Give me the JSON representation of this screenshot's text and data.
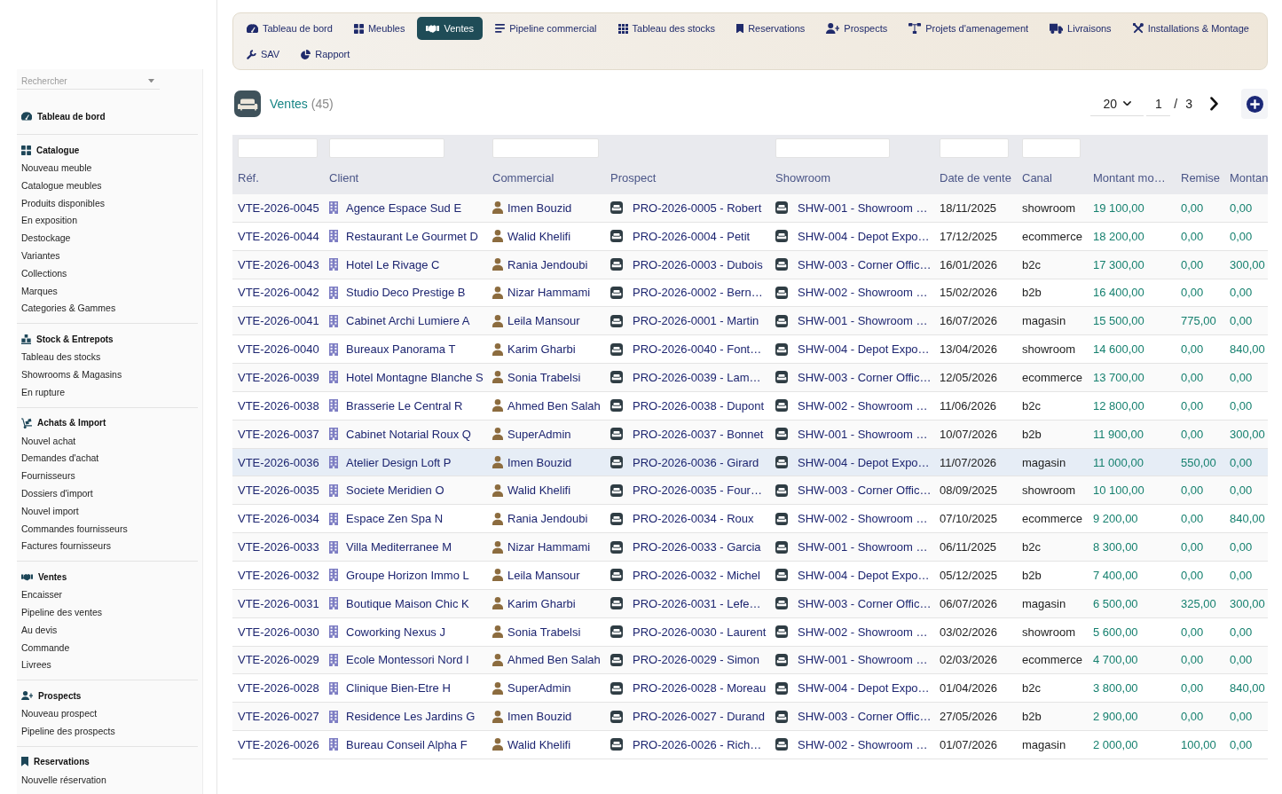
{
  "sidebar": {
    "search": {
      "placeholder": "Rechercher"
    },
    "sections": [
      {
        "title": "Tableau de bord"
      },
      {
        "title": "Catalogue",
        "items": [
          "Nouveau meuble",
          "Catalogue meubles",
          "Produits disponibles",
          "En exposition",
          "Destockage",
          "Variantes",
          "Collections",
          "Marques",
          "Categories & Gammes"
        ]
      },
      {
        "title": "Stock & Entrepots",
        "items": [
          "Tableau des stocks",
          "Showrooms & Magasins",
          "En rupture"
        ]
      },
      {
        "title": "Achats & Import",
        "items": [
          "Nouvel achat",
          "Demandes d'achat",
          "Fournisseurs",
          "Dossiers d'import",
          "Nouvel import",
          "Commandes fournisseurs",
          "Factures fournisseurs"
        ]
      },
      {
        "title": "Ventes",
        "items": [
          "Encaisser",
          "Pipeline des ventes",
          "Au devis",
          "Commande",
          "Livrees"
        ]
      },
      {
        "title": "Prospects",
        "items": [
          "Nouveau prospect",
          "Pipeline des prospects"
        ]
      },
      {
        "title": "Reservations",
        "items": [
          "Nouvelle réservation"
        ]
      }
    ]
  },
  "tabs": [
    {
      "label": "Tableau de bord",
      "selected": false
    },
    {
      "label": "Meubles",
      "selected": false
    },
    {
      "label": "Ventes",
      "selected": true
    },
    {
      "label": "Pipeline commercial",
      "selected": false
    },
    {
      "label": "Tableau des stocks",
      "selected": false
    },
    {
      "label": "Reservations",
      "selected": false
    },
    {
      "label": "Prospects",
      "selected": false
    },
    {
      "label": "Projets d'amenagement",
      "selected": false
    },
    {
      "label": "Livraisons",
      "selected": false
    },
    {
      "label": "Installations & Montage",
      "selected": false
    },
    {
      "label": "SAV",
      "selected": false
    },
    {
      "label": "Rapport",
      "selected": false
    }
  ],
  "header": {
    "title": "Ventes",
    "count": "(45)"
  },
  "pagination": {
    "page_size": "20",
    "page": "1",
    "separator": "/",
    "page_count": "3"
  },
  "table": {
    "columns": [
      {
        "label": "Réf.",
        "filter": true
      },
      {
        "label": "Client",
        "filter": true
      },
      {
        "label": "Commercial",
        "filter": true
      },
      {
        "label": "Prospect",
        "filter": false
      },
      {
        "label": "Showroom",
        "filter": true
      },
      {
        "label": "Date de vente",
        "filter": true
      },
      {
        "label": "Canal",
        "filter": true
      },
      {
        "label": "Montant mo…",
        "filter": false
      },
      {
        "label": "Remise",
        "filter": false
      },
      {
        "label": "Montan",
        "filter": false
      }
    ],
    "rows": [
      {
        "ref": "VTE-2026-0045",
        "client": "Agence Espace Sud E",
        "commercial": "Imen Bouzid",
        "prospect": "PRO-2026-0005 - Robert",
        "showroom": "SHW-001 - Showroom …",
        "date": "18/11/2025",
        "canal": "showroom",
        "montant": "19 100,00",
        "remise": "0,00",
        "column_10": "0,00",
        "selected": false
      },
      {
        "ref": "VTE-2026-0044",
        "client": "Restaurant Le Gourmet D",
        "commercial": "Walid Khelifi",
        "prospect": "PRO-2026-0004 - Petit",
        "showroom": "SHW-004 - Depot Expo…",
        "date": "17/12/2025",
        "canal": "ecommerce",
        "montant": "18 200,00",
        "remise": "0,00",
        "column_10": "0,00",
        "selected": false
      },
      {
        "ref": "VTE-2026-0043",
        "client": "Hotel Le Rivage C",
        "commercial": "Rania Jendoubi",
        "prospect": "PRO-2026-0003 - Dubois",
        "showroom": "SHW-003 - Corner Offic…",
        "date": "16/01/2026",
        "canal": "b2c",
        "montant": "17 300,00",
        "remise": "0,00",
        "column_10": "300,00",
        "selected": false
      },
      {
        "ref": "VTE-2026-0042",
        "client": "Studio Deco Prestige B",
        "commercial": "Nizar Hammami",
        "prospect": "PRO-2026-0002 - Bern…",
        "showroom": "SHW-002 - Showroom …",
        "date": "15/02/2026",
        "canal": "b2b",
        "montant": "16 400,00",
        "remise": "0,00",
        "column_10": "0,00",
        "selected": false
      },
      {
        "ref": "VTE-2026-0041",
        "client": "Cabinet Archi Lumiere A",
        "commercial": "Leila Mansour",
        "prospect": "PRO-2026-0001 - Martin",
        "showroom": "SHW-001 - Showroom …",
        "date": "16/07/2026",
        "canal": "magasin",
        "montant": "15 500,00",
        "remise": "775,00",
        "column_10": "0,00",
        "selected": false
      },
      {
        "ref": "VTE-2026-0040",
        "client": "Bureaux Panorama T",
        "commercial": "Karim Gharbi",
        "prospect": "PRO-2026-0040 - Font…",
        "showroom": "SHW-004 - Depot Expo…",
        "date": "13/04/2026",
        "canal": "showroom",
        "montant": "14 600,00",
        "remise": "0,00",
        "column_10": "840,00",
        "selected": false
      },
      {
        "ref": "VTE-2026-0039",
        "client": "Hotel Montagne Blanche S",
        "commercial": "Sonia Trabelsi",
        "prospect": "PRO-2026-0039 - Lam…",
        "showroom": "SHW-003 - Corner Offic…",
        "date": "12/05/2026",
        "canal": "ecommerce",
        "montant": "13 700,00",
        "remise": "0,00",
        "column_10": "0,00",
        "selected": false
      },
      {
        "ref": "VTE-2026-0038",
        "client": "Brasserie Le Central R",
        "commercial": "Ahmed Ben Salah",
        "prospect": "PRO-2026-0038 - Dupont",
        "showroom": "SHW-002 - Showroom …",
        "date": "11/06/2026",
        "canal": "b2c",
        "montant": "12 800,00",
        "remise": "0,00",
        "column_10": "0,00",
        "selected": false
      },
      {
        "ref": "VTE-2026-0037",
        "client": "Cabinet Notarial Roux Q",
        "commercial": "SuperAdmin",
        "prospect": "PRO-2026-0037 - Bonnet",
        "showroom": "SHW-001 - Showroom …",
        "date": "10/07/2026",
        "canal": "b2b",
        "montant": "11 900,00",
        "remise": "0,00",
        "column_10": "300,00",
        "selected": false
      },
      {
        "ref": "VTE-2026-0036",
        "client": "Atelier Design Loft P",
        "commercial": "Imen Bouzid",
        "prospect": "PRO-2026-0036 - Girard",
        "showroom": "SHW-004 - Depot Expo…",
        "date": "11/07/2026",
        "canal": "magasin",
        "montant": "11 000,00",
        "remise": "550,00",
        "column_10": "0,00",
        "selected": true
      },
      {
        "ref": "VTE-2026-0035",
        "client": "Societe Meridien O",
        "commercial": "Walid Khelifi",
        "prospect": "PRO-2026-0035 - Four…",
        "showroom": "SHW-003 - Corner Offic…",
        "date": "08/09/2025",
        "canal": "showroom",
        "montant": "10 100,00",
        "remise": "0,00",
        "column_10": "0,00",
        "selected": false
      },
      {
        "ref": "VTE-2026-0034",
        "client": "Espace Zen Spa N",
        "commercial": "Rania Jendoubi",
        "prospect": "PRO-2026-0034 - Roux",
        "showroom": "SHW-002 - Showroom …",
        "date": "07/10/2025",
        "canal": "ecommerce",
        "montant": "9 200,00",
        "remise": "0,00",
        "column_10": "840,00",
        "selected": false
      },
      {
        "ref": "VTE-2026-0033",
        "client": "Villa Mediterranee M",
        "commercial": "Nizar Hammami",
        "prospect": "PRO-2026-0033 - Garcia",
        "showroom": "SHW-001 - Showroom …",
        "date": "06/11/2025",
        "canal": "b2c",
        "montant": "8 300,00",
        "remise": "0,00",
        "column_10": "0,00",
        "selected": false
      },
      {
        "ref": "VTE-2026-0032",
        "client": "Groupe Horizon Immo L",
        "commercial": "Leila Mansour",
        "prospect": "PRO-2026-0032 - Michel",
        "showroom": "SHW-004 - Depot Expo…",
        "date": "05/12/2025",
        "canal": "b2b",
        "montant": "7 400,00",
        "remise": "0,00",
        "column_10": "0,00",
        "selected": false
      },
      {
        "ref": "VTE-2026-0031",
        "client": "Boutique Maison Chic K",
        "commercial": "Karim Gharbi",
        "prospect": "PRO-2026-0031 - Lefe…",
        "showroom": "SHW-003 - Corner Offic…",
        "date": "06/07/2026",
        "canal": "magasin",
        "montant": "6 500,00",
        "remise": "325,00",
        "column_10": "300,00",
        "selected": false
      },
      {
        "ref": "VTE-2026-0030",
        "client": "Coworking Nexus J",
        "commercial": "Sonia Trabelsi",
        "prospect": "PRO-2026-0030 - Laurent",
        "showroom": "SHW-002 - Showroom …",
        "date": "03/02/2026",
        "canal": "showroom",
        "montant": "5 600,00",
        "remise": "0,00",
        "column_10": "0,00",
        "selected": false
      },
      {
        "ref": "VTE-2026-0029",
        "client": "Ecole Montessori Nord I",
        "commercial": "Ahmed Ben Salah",
        "prospect": "PRO-2026-0029 - Simon",
        "showroom": "SHW-001 - Showroom …",
        "date": "02/03/2026",
        "canal": "ecommerce",
        "montant": "4 700,00",
        "remise": "0,00",
        "column_10": "0,00",
        "selected": false
      },
      {
        "ref": "VTE-2026-0028",
        "client": "Clinique Bien-Etre H",
        "commercial": "SuperAdmin",
        "prospect": "PRO-2026-0028 - Moreau",
        "showroom": "SHW-004 - Depot Expo…",
        "date": "01/04/2026",
        "canal": "b2c",
        "montant": "3 800,00",
        "remise": "0,00",
        "column_10": "840,00",
        "selected": false
      },
      {
        "ref": "VTE-2026-0027",
        "client": "Residence Les Jardins G",
        "commercial": "Imen Bouzid",
        "prospect": "PRO-2026-0027 - Durand",
        "showroom": "SHW-003 - Corner Offic…",
        "date": "27/05/2026",
        "canal": "b2b",
        "montant": "2 900,00",
        "remise": "0,00",
        "column_10": "0,00",
        "selected": false
      },
      {
        "ref": "VTE-2026-0026",
        "client": "Bureau Conseil Alpha F",
        "commercial": "Walid Khelifi",
        "prospect": "PRO-2026-0026 - Rich…",
        "showroom": "SHW-002 - Showroom …",
        "date": "01/07/2026",
        "canal": "magasin",
        "montant": "2 000,00",
        "remise": "100,00",
        "column_10": "0,00",
        "selected": false
      }
    ]
  }
}
